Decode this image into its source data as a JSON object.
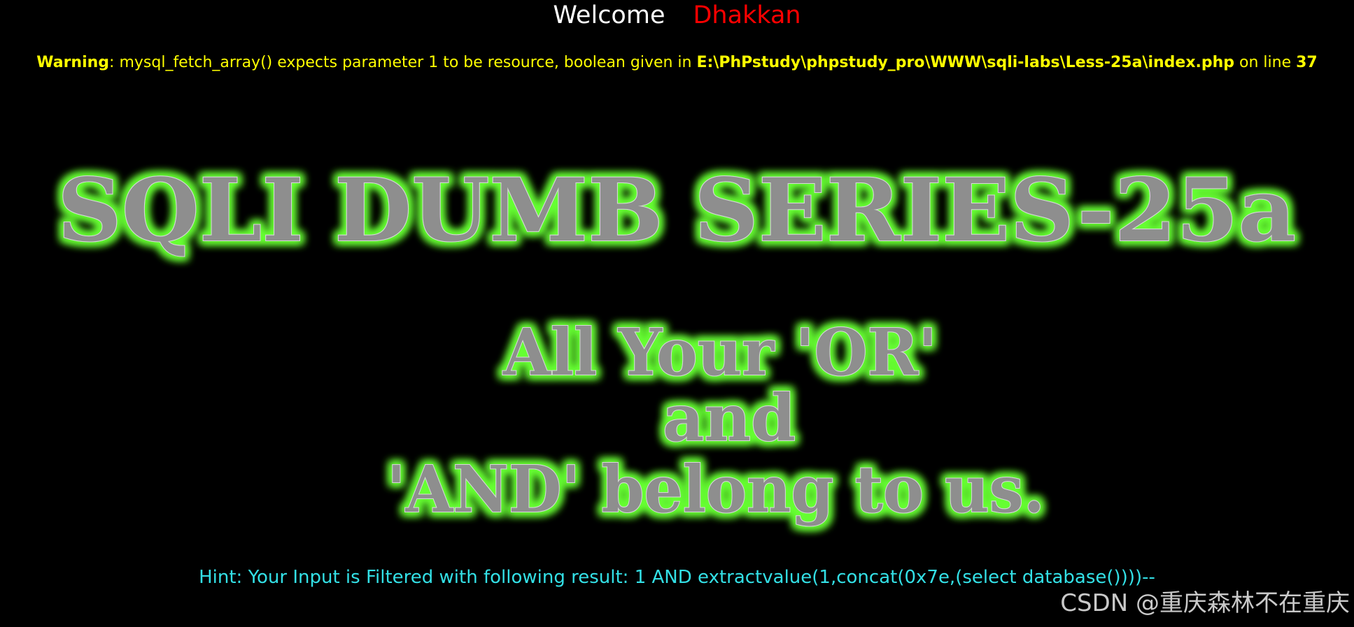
{
  "welcome": {
    "word": "Welcome",
    "name": "Dhakkan",
    "word_color": "#ffffff",
    "name_color": "#ff0000"
  },
  "warning": {
    "label": "Warning",
    "message": ": mysql_fetch_array() expects parameter 1 to be resource, boolean given in ",
    "path": "E:\\PhPstudy\\phpstudy_pro\\WWW\\sqli-labs\\Less-25a\\index.php",
    "mid": " on line ",
    "line": "37",
    "color": "#ffff00"
  },
  "banner": {
    "title": "SQLI DUMB SERIES-25a",
    "line1": "All Your 'OR'",
    "line2": "and",
    "line3": "'AND' belong to us.",
    "glow_color": "#66ff33",
    "fill_color": "#8e8e8e"
  },
  "hint": {
    "text": "Hint: Your Input is Filtered with following result: 1 AND extractvalue(1,concat(0x7e,(select database())))--",
    "color": "#33e0e6"
  },
  "watermark": {
    "text": "CSDN @重庆森林不在重庆"
  }
}
